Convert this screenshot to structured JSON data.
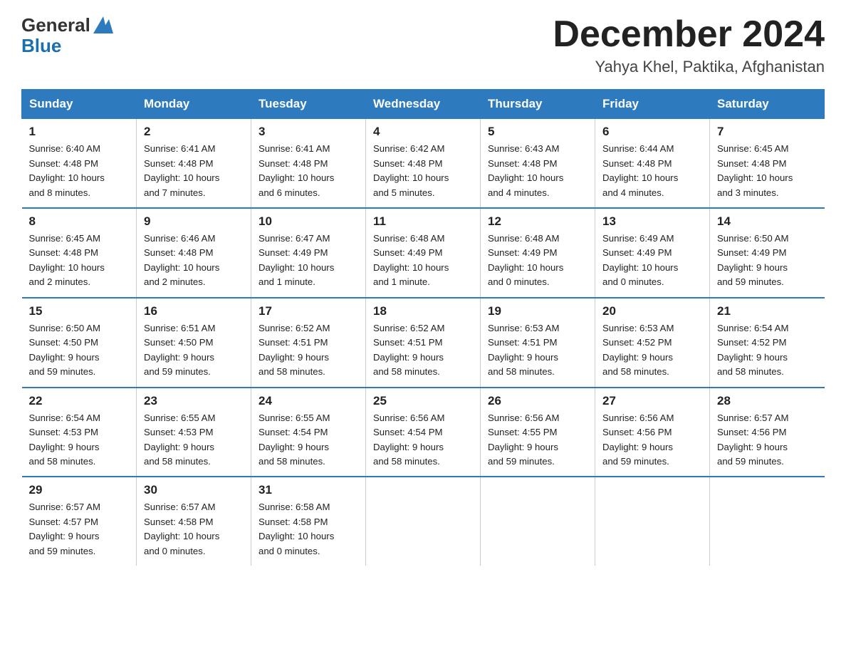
{
  "header": {
    "logo_general": "General",
    "logo_blue": "Blue",
    "title": "December 2024",
    "subtitle": "Yahya Khel, Paktika, Afghanistan"
  },
  "weekdays": [
    "Sunday",
    "Monday",
    "Tuesday",
    "Wednesday",
    "Thursday",
    "Friday",
    "Saturday"
  ],
  "weeks": [
    [
      {
        "day": "1",
        "info": "Sunrise: 6:40 AM\nSunset: 4:48 PM\nDaylight: 10 hours\nand 8 minutes."
      },
      {
        "day": "2",
        "info": "Sunrise: 6:41 AM\nSunset: 4:48 PM\nDaylight: 10 hours\nand 7 minutes."
      },
      {
        "day": "3",
        "info": "Sunrise: 6:41 AM\nSunset: 4:48 PM\nDaylight: 10 hours\nand 6 minutes."
      },
      {
        "day": "4",
        "info": "Sunrise: 6:42 AM\nSunset: 4:48 PM\nDaylight: 10 hours\nand 5 minutes."
      },
      {
        "day": "5",
        "info": "Sunrise: 6:43 AM\nSunset: 4:48 PM\nDaylight: 10 hours\nand 4 minutes."
      },
      {
        "day": "6",
        "info": "Sunrise: 6:44 AM\nSunset: 4:48 PM\nDaylight: 10 hours\nand 4 minutes."
      },
      {
        "day": "7",
        "info": "Sunrise: 6:45 AM\nSunset: 4:48 PM\nDaylight: 10 hours\nand 3 minutes."
      }
    ],
    [
      {
        "day": "8",
        "info": "Sunrise: 6:45 AM\nSunset: 4:48 PM\nDaylight: 10 hours\nand 2 minutes."
      },
      {
        "day": "9",
        "info": "Sunrise: 6:46 AM\nSunset: 4:48 PM\nDaylight: 10 hours\nand 2 minutes."
      },
      {
        "day": "10",
        "info": "Sunrise: 6:47 AM\nSunset: 4:49 PM\nDaylight: 10 hours\nand 1 minute."
      },
      {
        "day": "11",
        "info": "Sunrise: 6:48 AM\nSunset: 4:49 PM\nDaylight: 10 hours\nand 1 minute."
      },
      {
        "day": "12",
        "info": "Sunrise: 6:48 AM\nSunset: 4:49 PM\nDaylight: 10 hours\nand 0 minutes."
      },
      {
        "day": "13",
        "info": "Sunrise: 6:49 AM\nSunset: 4:49 PM\nDaylight: 10 hours\nand 0 minutes."
      },
      {
        "day": "14",
        "info": "Sunrise: 6:50 AM\nSunset: 4:49 PM\nDaylight: 9 hours\nand 59 minutes."
      }
    ],
    [
      {
        "day": "15",
        "info": "Sunrise: 6:50 AM\nSunset: 4:50 PM\nDaylight: 9 hours\nand 59 minutes."
      },
      {
        "day": "16",
        "info": "Sunrise: 6:51 AM\nSunset: 4:50 PM\nDaylight: 9 hours\nand 59 minutes."
      },
      {
        "day": "17",
        "info": "Sunrise: 6:52 AM\nSunset: 4:51 PM\nDaylight: 9 hours\nand 58 minutes."
      },
      {
        "day": "18",
        "info": "Sunrise: 6:52 AM\nSunset: 4:51 PM\nDaylight: 9 hours\nand 58 minutes."
      },
      {
        "day": "19",
        "info": "Sunrise: 6:53 AM\nSunset: 4:51 PM\nDaylight: 9 hours\nand 58 minutes."
      },
      {
        "day": "20",
        "info": "Sunrise: 6:53 AM\nSunset: 4:52 PM\nDaylight: 9 hours\nand 58 minutes."
      },
      {
        "day": "21",
        "info": "Sunrise: 6:54 AM\nSunset: 4:52 PM\nDaylight: 9 hours\nand 58 minutes."
      }
    ],
    [
      {
        "day": "22",
        "info": "Sunrise: 6:54 AM\nSunset: 4:53 PM\nDaylight: 9 hours\nand 58 minutes."
      },
      {
        "day": "23",
        "info": "Sunrise: 6:55 AM\nSunset: 4:53 PM\nDaylight: 9 hours\nand 58 minutes."
      },
      {
        "day": "24",
        "info": "Sunrise: 6:55 AM\nSunset: 4:54 PM\nDaylight: 9 hours\nand 58 minutes."
      },
      {
        "day": "25",
        "info": "Sunrise: 6:56 AM\nSunset: 4:54 PM\nDaylight: 9 hours\nand 58 minutes."
      },
      {
        "day": "26",
        "info": "Sunrise: 6:56 AM\nSunset: 4:55 PM\nDaylight: 9 hours\nand 59 minutes."
      },
      {
        "day": "27",
        "info": "Sunrise: 6:56 AM\nSunset: 4:56 PM\nDaylight: 9 hours\nand 59 minutes."
      },
      {
        "day": "28",
        "info": "Sunrise: 6:57 AM\nSunset: 4:56 PM\nDaylight: 9 hours\nand 59 minutes."
      }
    ],
    [
      {
        "day": "29",
        "info": "Sunrise: 6:57 AM\nSunset: 4:57 PM\nDaylight: 9 hours\nand 59 minutes."
      },
      {
        "day": "30",
        "info": "Sunrise: 6:57 AM\nSunset: 4:58 PM\nDaylight: 10 hours\nand 0 minutes."
      },
      {
        "day": "31",
        "info": "Sunrise: 6:58 AM\nSunset: 4:58 PM\nDaylight: 10 hours\nand 0 minutes."
      },
      {
        "day": "",
        "info": ""
      },
      {
        "day": "",
        "info": ""
      },
      {
        "day": "",
        "info": ""
      },
      {
        "day": "",
        "info": ""
      }
    ]
  ]
}
